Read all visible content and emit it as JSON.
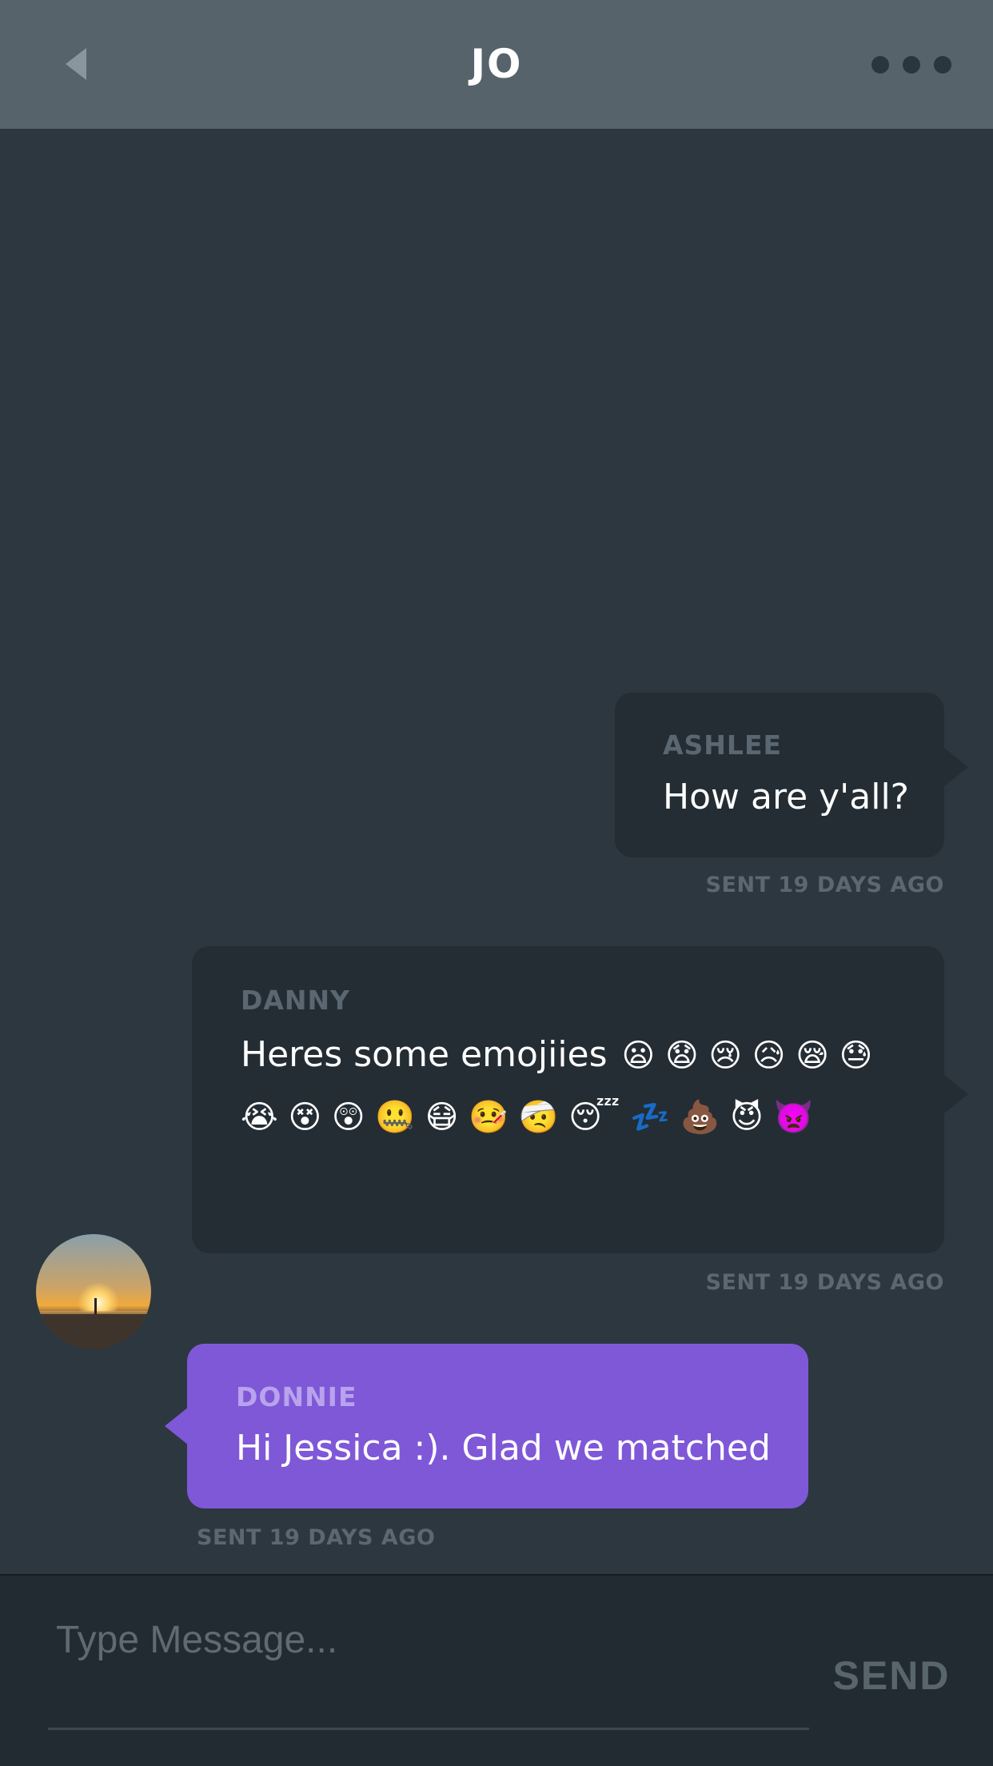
{
  "header": {
    "title": "JO",
    "back_icon": "back-arrow-icon",
    "more_icon": "more-dots-icon"
  },
  "messages": [
    {
      "sender": "ASHLEE",
      "text": "How are y'all?",
      "sent": "SENT 19 DAYS AGO",
      "align": "right"
    },
    {
      "sender": "DANNY",
      "text": "Heres some emojiies",
      "emojis": "😦 😧 😢 😥 😪 😓 😭 😵 😲 🤐 😷 🤒 🤕 😴 💤 💩 😈 👿",
      "sent": "SENT 19 DAYS AGO",
      "align": "right"
    },
    {
      "sender": "DONNIE",
      "text": "Hi Jessica :). Glad we matched",
      "sent": "SENT 19 DAYS AGO",
      "align": "left",
      "avatar_icon": "sunset-avatar"
    }
  ],
  "composer": {
    "placeholder": "Type Message...",
    "value": "",
    "send_label": "SEND"
  },
  "colors": {
    "background": "#2d3740",
    "header": "#57636b",
    "bubble_dark": "#242d34",
    "bubble_purple": "#7f58d8",
    "meta_text": "#5c6870"
  }
}
